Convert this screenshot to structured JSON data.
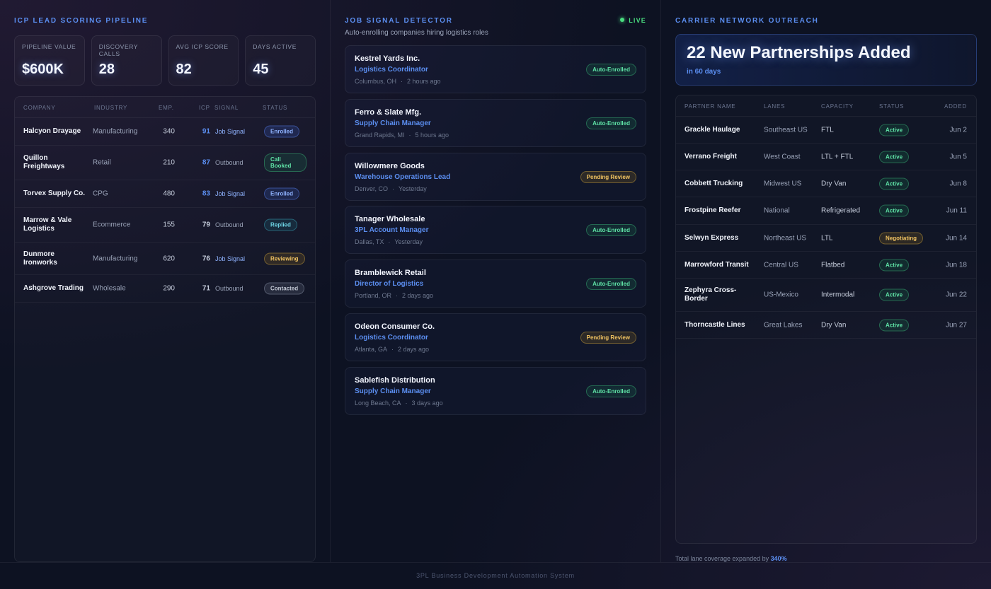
{
  "lead_scoring": {
    "title": "ICP LEAD SCORING PIPELINE",
    "stats": [
      {
        "label": "PIPELINE VALUE",
        "value": "$600K"
      },
      {
        "label": "DISCOVERY CALLS",
        "value": "28"
      },
      {
        "label": "AVG ICP SCORE",
        "value": "82"
      },
      {
        "label": "DAYS ACTIVE",
        "value": "45"
      }
    ],
    "columns": [
      "COMPANY",
      "INDUSTRY",
      "EMP.",
      "ICP",
      "SIGNAL",
      "STATUS"
    ],
    "rows": [
      {
        "company": "Halcyon Drayage",
        "industry": "Manufacturing",
        "emp": "340",
        "icp": "91",
        "signal": "Job Signal",
        "status": "Enrolled",
        "status_style": "blue"
      },
      {
        "company": "Quillon Freightways",
        "industry": "Retail",
        "emp": "210",
        "icp": "87",
        "signal": "Outbound",
        "status": "Call Booked",
        "status_style": "green"
      },
      {
        "company": "Torvex Supply Co.",
        "industry": "CPG",
        "emp": "480",
        "icp": "83",
        "signal": "Job Signal",
        "status": "Enrolled",
        "status_style": "blue"
      },
      {
        "company": "Marrow & Vale Logistics",
        "industry": "Ecommerce",
        "emp": "155",
        "icp": "79",
        "signal": "Outbound",
        "status": "Replied",
        "status_style": "teal"
      },
      {
        "company": "Dunmore Ironworks",
        "industry": "Manufacturing",
        "emp": "620",
        "icp": "76",
        "signal": "Job Signal",
        "status": "Reviewing",
        "status_style": "amber"
      },
      {
        "company": "Ashgrove Trading",
        "industry": "Wholesale",
        "emp": "290",
        "icp": "71",
        "signal": "Outbound",
        "status": "Contacted",
        "status_style": "gray"
      }
    ]
  },
  "job_signals": {
    "title": "JOB SIGNAL DETECTOR",
    "live_label": "LIVE",
    "subtitle": "Auto-enrolling companies hiring logistics roles",
    "cards": [
      {
        "company": "Kestrel Yards Inc.",
        "role": "Logistics Coordinator",
        "location": "Columbus, OH",
        "time": "2 hours ago",
        "status": "Auto-Enrolled",
        "status_style": "green"
      },
      {
        "company": "Ferro & Slate Mfg.",
        "role": "Supply Chain Manager",
        "location": "Grand Rapids, MI",
        "time": "5 hours ago",
        "status": "Auto-Enrolled",
        "status_style": "green"
      },
      {
        "company": "Willowmere Goods",
        "role": "Warehouse Operations Lead",
        "location": "Denver, CO",
        "time": "Yesterday",
        "status": "Pending Review",
        "status_style": "amber"
      },
      {
        "company": "Tanager Wholesale",
        "role": "3PL Account Manager",
        "location": "Dallas, TX",
        "time": "Yesterday",
        "status": "Auto-Enrolled",
        "status_style": "green"
      },
      {
        "company": "Bramblewick Retail",
        "role": "Director of Logistics",
        "location": "Portland, OR",
        "time": "2 days ago",
        "status": "Auto-Enrolled",
        "status_style": "green"
      },
      {
        "company": "Odeon Consumer Co.",
        "role": "Logistics Coordinator",
        "location": "Atlanta, GA",
        "time": "2 days ago",
        "status": "Pending Review",
        "status_style": "amber"
      },
      {
        "company": "Sablefish Distribution",
        "role": "Supply Chain Manager",
        "location": "Long Beach, CA",
        "time": "3 days ago",
        "status": "Auto-Enrolled",
        "status_style": "green"
      }
    ]
  },
  "carrier": {
    "title": "CARRIER NETWORK OUTREACH",
    "hero_title": "22 New Partnerships Added",
    "hero_sub": "in 60 days",
    "columns": [
      "PARTNER NAME",
      "LANES",
      "CAPACITY",
      "STATUS",
      "ADDED"
    ],
    "rows": [
      {
        "name": "Grackle Haulage",
        "lanes": "Southeast US",
        "capacity": "FTL",
        "status": "Active",
        "status_style": "green",
        "added": "Jun 2"
      },
      {
        "name": "Verrano Freight",
        "lanes": "West Coast",
        "capacity": "LTL + FTL",
        "status": "Active",
        "status_style": "green",
        "added": "Jun 5"
      },
      {
        "name": "Cobbett Trucking",
        "lanes": "Midwest US",
        "capacity": "Dry Van",
        "status": "Active",
        "status_style": "green",
        "added": "Jun 8"
      },
      {
        "name": "Frostpine Reefer",
        "lanes": "National",
        "capacity": "Refrigerated",
        "status": "Active",
        "status_style": "green",
        "added": "Jun 11"
      },
      {
        "name": "Selwyn Express",
        "lanes": "Northeast US",
        "capacity": "LTL",
        "status": "Negotiating",
        "status_style": "amber",
        "added": "Jun 14"
      },
      {
        "name": "Marrowford Transit",
        "lanes": "Central US",
        "capacity": "Flatbed",
        "status": "Active",
        "status_style": "green",
        "added": "Jun 18"
      },
      {
        "name": "Zephyra Cross-Border",
        "lanes": "US-Mexico",
        "capacity": "Intermodal",
        "status": "Active",
        "status_style": "green",
        "added": "Jun 22"
      },
      {
        "name": "Thorncastle Lines",
        "lanes": "Great Lakes",
        "capacity": "Dry Van",
        "status": "Active",
        "status_style": "green",
        "added": "Jun 27"
      }
    ],
    "footnote_prefix": "Total lane coverage expanded by",
    "footnote_value": "340%"
  },
  "footer": "3PL Business Development Automation System"
}
